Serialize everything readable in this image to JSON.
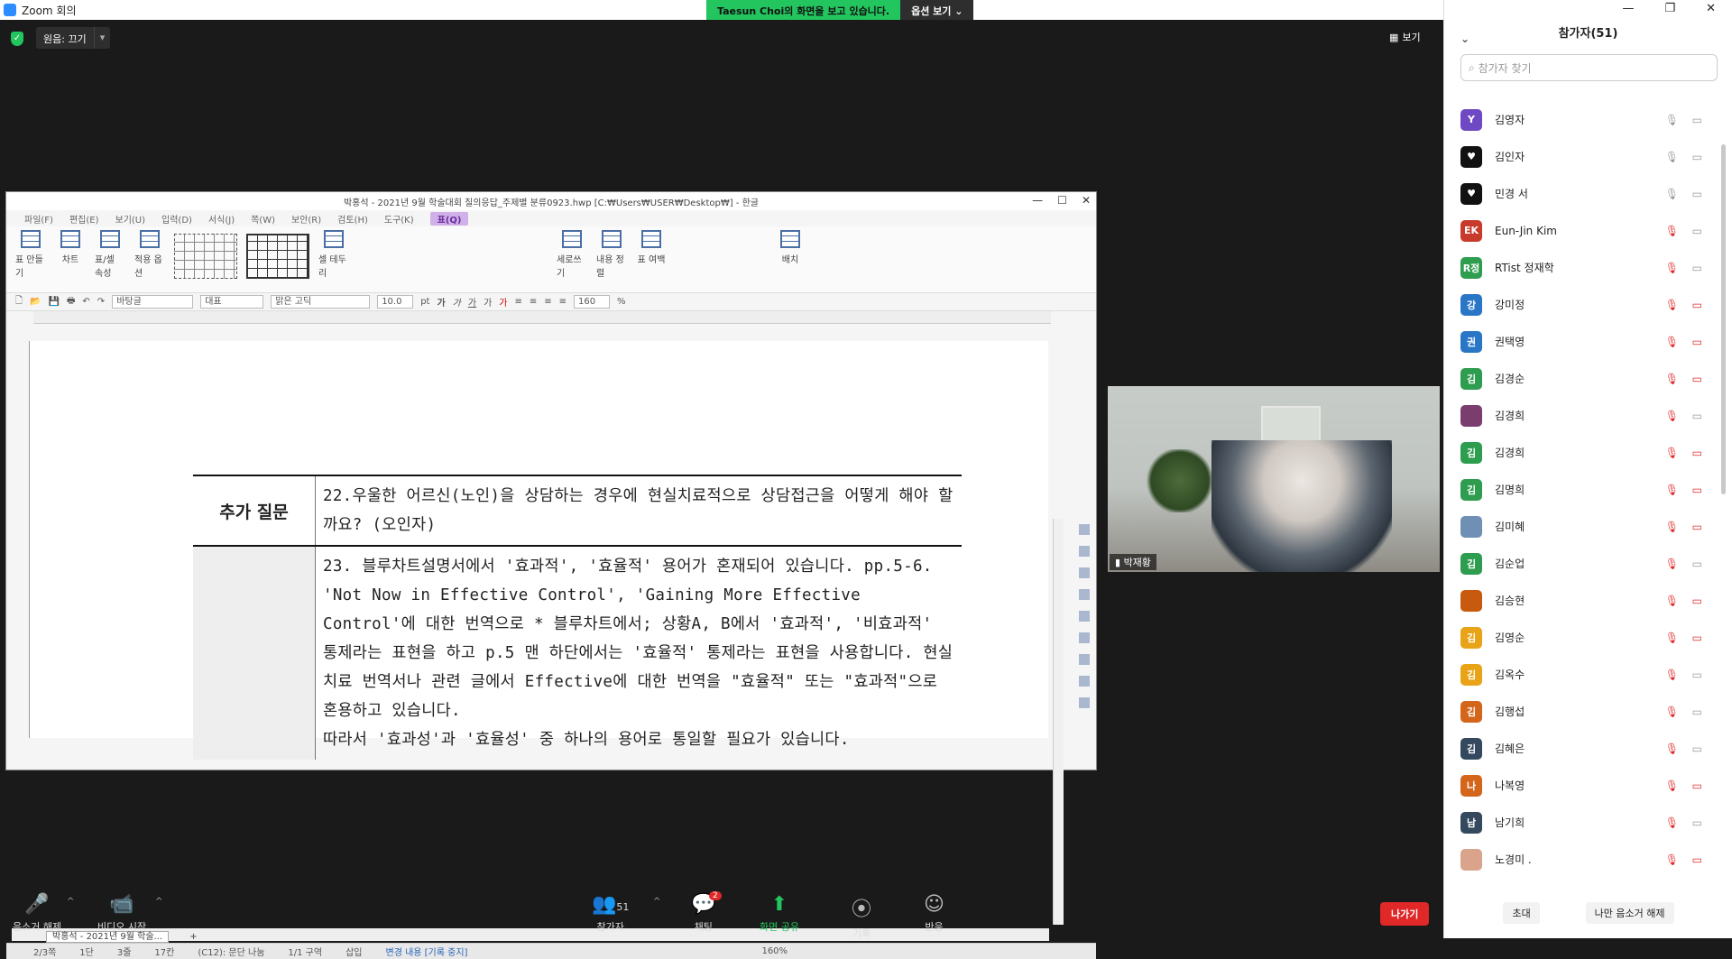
{
  "app": {
    "title": "Zoom 회의"
  },
  "banner": {
    "viewing": "Taesun Choi의 화면을 보고 있습니다.",
    "options": "옵션 보기"
  },
  "top": {
    "original_sound": "원음: 끄기",
    "view": "보기"
  },
  "hwp": {
    "window_title": "박홍석 - 2021년 9월 학술대회 질의응답_주제별 분류0923.hwp [C:₩Users₩USER₩Desktop₩] - 한글",
    "menus": [
      "파일(F)",
      "편집(E)",
      "보기(U)",
      "입력(D)",
      "서식(J)",
      "쪽(W)",
      "보안(R)",
      "검토(H)",
      "도구(K)",
      "표(Q)"
    ],
    "ribbon": [
      "표 만들기",
      "차트",
      "표/셀 속성",
      "적용 옵션",
      "셀 테두리",
      "세로쓰기",
      "내용 정렬",
      "표 여백",
      "배치"
    ],
    "format": {
      "style": "바탕글",
      "lang": "대표",
      "font": "맑은 고딕",
      "size": "10.0",
      "unit": "pt",
      "zoom": "160",
      "zoom_unit": "%"
    },
    "doc": {
      "q22_label": "추가 질문",
      "q22": "22.우울한 어르신(노인)을 상담하는 경우에 현실치료적으로 상담접근을 어떻게 해야 할까요? (오인자)",
      "q23": "23. 블루차트설명서에서 '효과적', '효율적' 용어가 혼재되어 있습니다. pp.5-6. 'Not Now in Effective Control', 'Gaining More Effective Control'에 대한 번역으로 * 블루차트에서; 상황A, B에서 '효과적', '비효과적' 통제라는 표현을 하고 p.5 맨 하단에서는 '효율적' 통제라는 표현을 사용합니다. 현실치료 번역서나 관련 글에서 Effective에 대한 번역을 \"효율적\" 또는 \"효과적\"으로 혼용하고 있습니다.",
      "q23b": "따라서 '효과성'과 '효율성' 중 하나의 용어로 통일할 필요가 있습니다."
    },
    "tab": "박홍석 - 2021년 9월 학술...",
    "status": [
      "2/3쪽",
      "1단",
      "3줄",
      "17칸",
      "(C12): 문단 나눔",
      "1/1 구역",
      "삽입",
      "변경 내용 [기록 중지]",
      "160%"
    ]
  },
  "video": {
    "name": "박재황"
  },
  "panel": {
    "title": "참가자(51)",
    "search_placeholder": "참가자 찾기",
    "participants": [
      {
        "initial": "Y",
        "name": "김영자",
        "color": "#6f49c4",
        "muted": false,
        "video_off": false
      },
      {
        "initial": "♥",
        "name": "김인자",
        "color": "#111111",
        "muted": false,
        "video_off": false
      },
      {
        "initial": "♥",
        "name": "민경 서",
        "color": "#111111",
        "muted": false,
        "video_off": false
      },
      {
        "initial": "EK",
        "name": "Eun-Jin Kim",
        "color": "#c83b2c",
        "muted": true,
        "video_off": false
      },
      {
        "initial": "R정",
        "name": "RTist 정재학",
        "color": "#2e9d4f",
        "muted": true,
        "video_off": false
      },
      {
        "initial": "강",
        "name": "강미정",
        "color": "#2a76c6",
        "muted": true,
        "video_off": true
      },
      {
        "initial": "권",
        "name": "권택영",
        "color": "#2a76c6",
        "muted": true,
        "video_off": true
      },
      {
        "initial": "김",
        "name": "김경순",
        "color": "#2e9d4f",
        "muted": true,
        "video_off": true
      },
      {
        "initial": "",
        "name": "김경희",
        "color": "#7a3d6e",
        "muted": true,
        "video_off": false
      },
      {
        "initial": "김",
        "name": "김경희",
        "color": "#2e9d4f",
        "muted": true,
        "video_off": true
      },
      {
        "initial": "김",
        "name": "김명희",
        "color": "#2e9d4f",
        "muted": true,
        "video_off": true
      },
      {
        "initial": "",
        "name": "김미혜",
        "color": "#6f8fb4",
        "muted": true,
        "video_off": true
      },
      {
        "initial": "김",
        "name": "김순업",
        "color": "#2e9d4f",
        "muted": true,
        "video_off": false
      },
      {
        "initial": "",
        "name": "김승현",
        "color": "#c85a10",
        "muted": true,
        "video_off": true
      },
      {
        "initial": "김",
        "name": "김영순",
        "color": "#e8a317",
        "muted": true,
        "video_off": true
      },
      {
        "initial": "김",
        "name": "김옥수",
        "color": "#e8a317",
        "muted": true,
        "video_off": false
      },
      {
        "initial": "김",
        "name": "김행섭",
        "color": "#d4661c",
        "muted": true,
        "video_off": false
      },
      {
        "initial": "김",
        "name": "김혜은",
        "color": "#34495e",
        "muted": true,
        "video_off": false
      },
      {
        "initial": "나",
        "name": "나복영",
        "color": "#d4661c",
        "muted": true,
        "video_off": true
      },
      {
        "initial": "남",
        "name": "남기희",
        "color": "#34495e",
        "muted": true,
        "video_off": false
      },
      {
        "initial": "",
        "name": "노경미 .",
        "color": "#d9a48b",
        "muted": true,
        "video_off": true
      }
    ],
    "invite": "초대",
    "unmute_me": "나만 음소거 해제"
  },
  "toolbar": {
    "unmute": "음소거 해제",
    "start_video": "비디오 시작",
    "participants": "참가자",
    "participant_count": "51",
    "chat": "채팅",
    "chat_badge": "2",
    "share": "화면 공유",
    "record": "기록",
    "reactions": "반응",
    "leave": "나가기"
  }
}
